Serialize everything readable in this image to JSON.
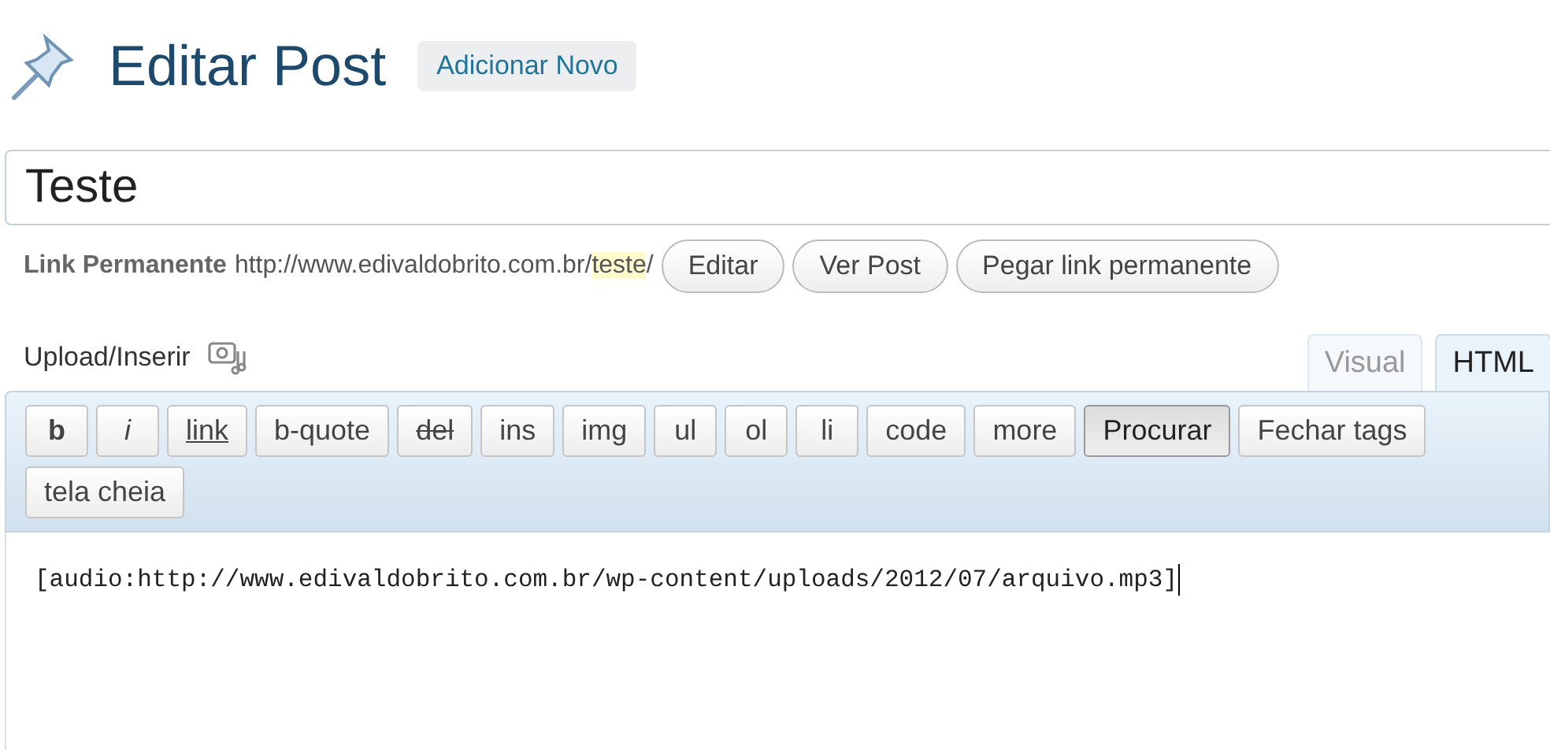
{
  "header": {
    "title": "Editar Post",
    "add_new": "Adicionar Novo"
  },
  "post_title": {
    "value": "Teste"
  },
  "permalink": {
    "label": "Link Permanente",
    "prefix": "http://www.edivaldobrito.com.br/",
    "slug": "teste",
    "suffix": "/",
    "buttons": [
      "Editar",
      "Ver Post",
      "Pegar link permanente"
    ]
  },
  "upload": {
    "label": "Upload/Inserir"
  },
  "editor_tabs": [
    {
      "label": "Visual",
      "selected": false
    },
    {
      "label": "HTML",
      "selected": true
    }
  ],
  "quicktags": [
    {
      "label": "b",
      "kind": "bold",
      "selected": false
    },
    {
      "label": "i",
      "kind": "italic",
      "selected": false
    },
    {
      "label": "link",
      "kind": "underline",
      "selected": false
    },
    {
      "label": "b-quote",
      "kind": "plain",
      "selected": false
    },
    {
      "label": "del",
      "kind": "strike",
      "selected": false
    },
    {
      "label": "ins",
      "kind": "plain",
      "selected": false
    },
    {
      "label": "img",
      "kind": "plain",
      "selected": false
    },
    {
      "label": "ul",
      "kind": "plain",
      "selected": false
    },
    {
      "label": "ol",
      "kind": "plain",
      "selected": false
    },
    {
      "label": "li",
      "kind": "plain",
      "selected": false
    },
    {
      "label": "code",
      "kind": "plain",
      "selected": false
    },
    {
      "label": "more",
      "kind": "plain",
      "selected": false
    },
    {
      "label": "Procurar",
      "kind": "plain",
      "selected": true
    },
    {
      "label": "Fechar tags",
      "kind": "plain",
      "selected": false
    },
    {
      "label": "tela cheia",
      "kind": "plain",
      "selected": false
    }
  ],
  "content": "[audio:http://www.edivaldobrito.com.br/wp-content/uploads/2012/07/arquivo.mp3]"
}
